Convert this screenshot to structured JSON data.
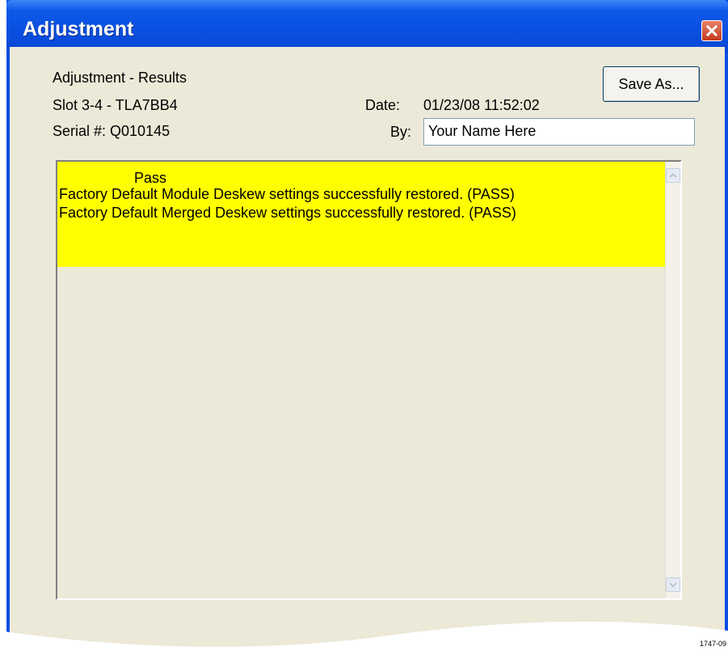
{
  "window": {
    "title": "Adjustment"
  },
  "header": {
    "line1": "Adjustment - Results",
    "line2": "Slot 3-4 - TLA7BB4",
    "serial": "Serial #: Q010145",
    "date_label": "Date:",
    "date_value": "01/23/08 11:52:02",
    "by_label": "By:",
    "by_value": "Your Name Here",
    "save_label": "Save As..."
  },
  "results": {
    "status": "Pass",
    "lines": [
      "Factory Default Module Deskew settings successfully restored. (PASS)",
      "Factory Default Merged Deskew settings successfully restored. (PASS)"
    ],
    "highlight_color": "#ffff00"
  },
  "figure_ref": "1747-09",
  "colors": {
    "titlebar": "#0a4fe0",
    "dialog_bg": "#ece9d8",
    "close": "#c33b1a"
  }
}
